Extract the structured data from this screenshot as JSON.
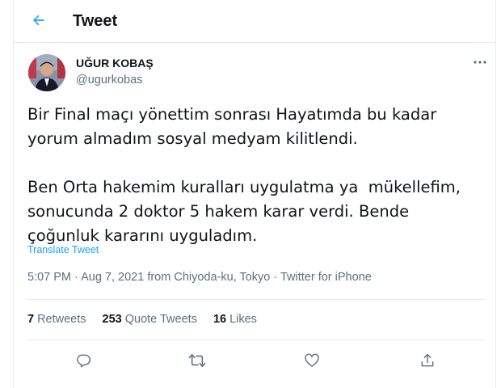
{
  "header": {
    "title": "Tweet"
  },
  "author": {
    "name": "UĞUR KOBAŞ",
    "handle": "@ugurkobas"
  },
  "tweet": {
    "text": "Bir Final maçı yönettim sonrası Hayatımda bu kadar\nyorum almadım sosyal medyam kilitlendi.\n\nBen Orta hakemim kuralları uygulatma ya  mükellefim,\nsonucunda 2 doktor 5 hakem karar verdi. Bende\nçoğunluk kararını uyguladım.",
    "translate_label": "Translate Tweet",
    "meta": "5:07 PM · Aug 7, 2021 from Chiyoda-ku, Tokyo · Twitter for iPhone"
  },
  "stats": {
    "retweets_count": "7",
    "retweets_label": "Retweets",
    "quotes_count": "253",
    "quotes_label": "Quote Tweets",
    "likes_count": "16",
    "likes_label": "Likes"
  },
  "icons": {
    "back": "arrow-left-icon",
    "more": "more-horizontal-icon",
    "reply": "reply-icon",
    "retweet": "retweet-icon",
    "like": "heart-icon",
    "share": "share-icon"
  },
  "colors": {
    "accent": "#1da1f2",
    "secondary_text": "#5b7083",
    "border": "#e6ecf0"
  }
}
